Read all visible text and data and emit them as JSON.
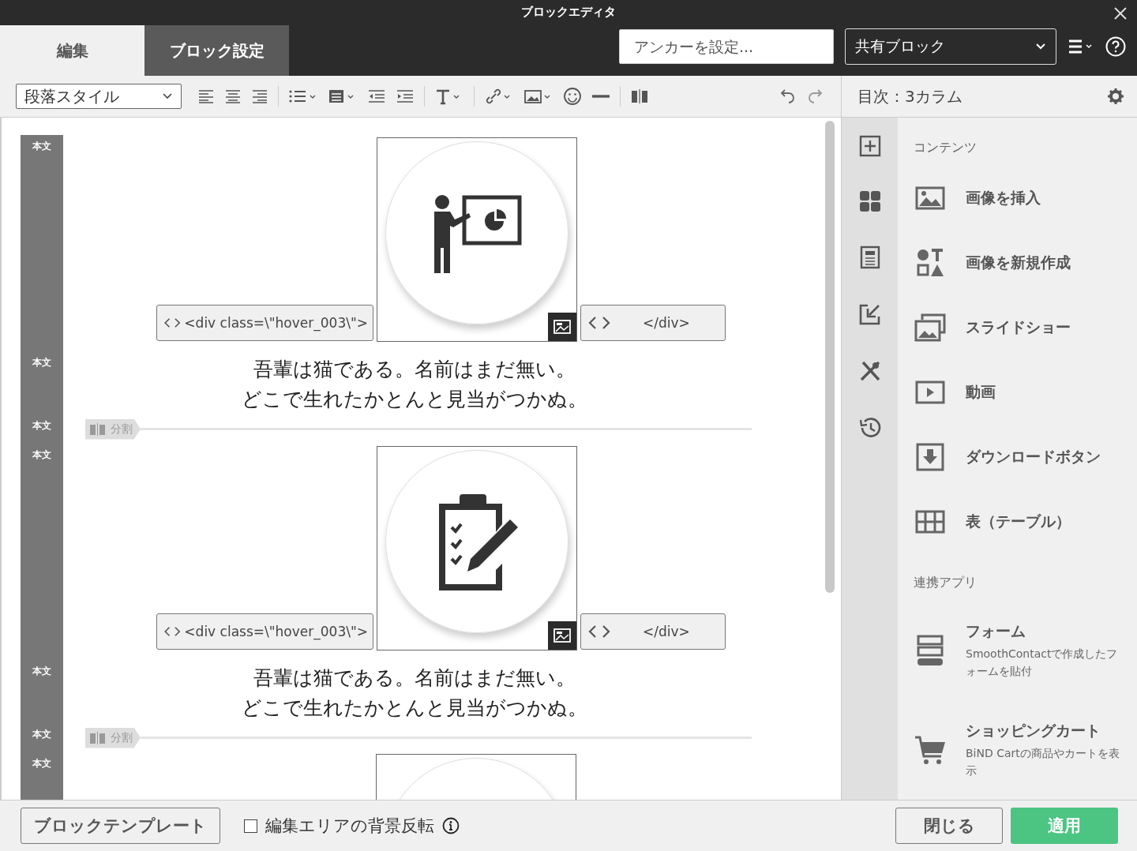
{
  "window": {
    "title": "ブロックエディタ"
  },
  "tabs": [
    {
      "label": "編集",
      "selected": true
    },
    {
      "label": "ブロック設定",
      "selected": false
    }
  ],
  "anchor_field": {
    "placeholder": "アンカーを設定..."
  },
  "block_select": {
    "value": "共有ブロック"
  },
  "toolbar": {
    "paragraph_style": "段落スタイル"
  },
  "panel_title": "目次：3カラム",
  "editor": {
    "rows": [
      {
        "kind": "image",
        "label": "本文",
        "open_tag": "<div class=\\\"hover_003\\\">",
        "close_tag": "</div>"
      },
      {
        "kind": "text",
        "label": "本文",
        "lines": [
          "吾輩は猫である。名前はまだ無い。",
          "どこで生れたかとんと見当がつかぬ。"
        ]
      },
      {
        "kind": "divider",
        "label": "本文",
        "text": "分割"
      },
      {
        "kind": "image",
        "label": "本文",
        "open_tag": "<div class=\\\"hover_003\\\">",
        "close_tag": "</div>"
      },
      {
        "kind": "text",
        "label": "本文",
        "lines": [
          "吾輩は猫である。名前はまだ無い。",
          "どこで生れたかとんと見当がつかぬ。"
        ]
      },
      {
        "kind": "divider",
        "label": "本文",
        "text": "分割"
      },
      {
        "kind": "partial",
        "label": "本文"
      }
    ]
  },
  "panel": {
    "sections": [
      {
        "heading": "コンテンツ",
        "items": [
          {
            "label": "画像を挿入"
          },
          {
            "label": "画像を新規作成"
          },
          {
            "label": "スライドショー"
          },
          {
            "label": "動画"
          },
          {
            "label": "ダウンロードボタン"
          },
          {
            "label": "表（テーブル）"
          }
        ]
      },
      {
        "heading": "連携アプリ",
        "items": [
          {
            "label": "フォーム",
            "description": "SmoothContactで作成したフォームを貼付"
          },
          {
            "label": "ショッピングカート",
            "description": "BiND Cartの商品やカートを表示"
          }
        ]
      }
    ]
  },
  "footer": {
    "template_button": "ブロックテンプレート",
    "invert_checkbox": {
      "label": "編集エリアの背景反転",
      "checked": false
    },
    "close_button": "閉じる",
    "apply_button": "適用"
  }
}
